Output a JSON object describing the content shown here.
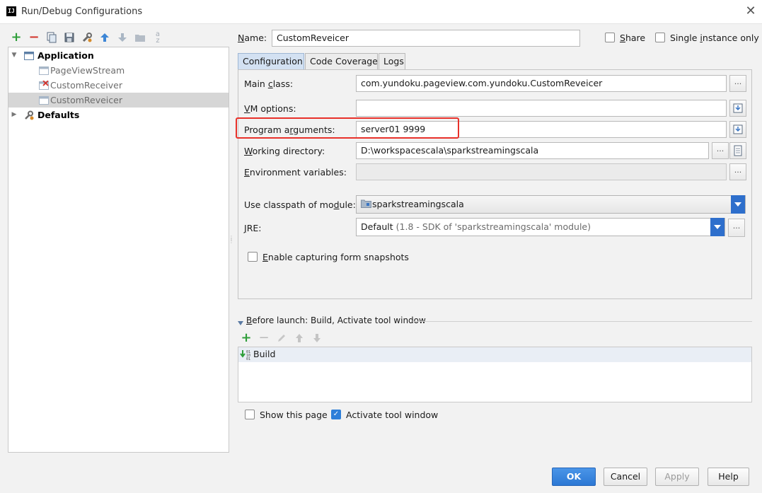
{
  "window": {
    "title": "Run/Debug Configurations",
    "app_icon_text": "IJ"
  },
  "toolbar": {
    "add": "+",
    "remove": "−"
  },
  "tree": {
    "application": {
      "label": "Application",
      "arrow": "▼"
    },
    "children": [
      {
        "label": "PageViewStream"
      },
      {
        "label": "CustomReceiver"
      },
      {
        "label": "CustomReveicer"
      }
    ],
    "defaults": {
      "label": "Defaults",
      "arrow": "▶"
    }
  },
  "name_field": {
    "label_pre": "",
    "label_u": "N",
    "label_post": "ame:",
    "value": "CustomReveicer"
  },
  "share": {
    "label_u": "S",
    "label_post": "hare",
    "checked": false
  },
  "single_instance": {
    "label_pre": "Single ",
    "label_u": "i",
    "label_post": "nstance only",
    "checked": false
  },
  "tabs": [
    {
      "label": "Configuration",
      "active": true
    },
    {
      "label": "Code Coverage",
      "active": false
    },
    {
      "label": "Logs",
      "active": false
    }
  ],
  "form": {
    "main_class": {
      "label_pre": "Main ",
      "label_u": "c",
      "label_post": "lass:",
      "value": "com.yundoku.pageview.com.yundoku.CustomReveicer",
      "button": "..."
    },
    "vm_options": {
      "label_pre": "",
      "label_u": "V",
      "label_post": "M options:",
      "value": ""
    },
    "program_arguments": {
      "label_pre": "Program a",
      "label_u": "r",
      "label_post": "guments:",
      "value": "server01 9999"
    },
    "working_directory": {
      "label_pre": "",
      "label_u": "W",
      "label_post": "orking directory:",
      "value": "D:\\workspacescala\\sparkstreamingscala",
      "button": "..."
    },
    "environment_variables": {
      "label_pre": "",
      "label_u": "E",
      "label_post": "nvironment variables:",
      "value": "",
      "button": "..."
    },
    "classpath_module": {
      "label_pre": "Use classpath of mo",
      "label_u": "d",
      "label_post": "ule:",
      "value": "sparkstreamingscala"
    },
    "jre": {
      "label_pre": "",
      "label_u": "J",
      "label_post": "RE:",
      "value_main": "Default",
      "value_detail": "(1.8 - SDK of 'sparkstreamingscala' module)",
      "button": "..."
    },
    "capture_snapshots": {
      "label_pre": "",
      "label_u": "E",
      "label_post": "nable capturing form snapshots",
      "checked": false
    }
  },
  "before_launch": {
    "header_pre": "",
    "header_u": "B",
    "header_post": "efore launch: Build, Activate tool window",
    "items": [
      {
        "label": "Build"
      }
    ]
  },
  "show_page": {
    "label": "Show this page",
    "checked": false
  },
  "activate_tool_window": {
    "label": "Activate tool window",
    "checked": true
  },
  "buttons": {
    "ok": "OK",
    "cancel": "Cancel",
    "apply": "Apply",
    "help": "Help"
  }
}
